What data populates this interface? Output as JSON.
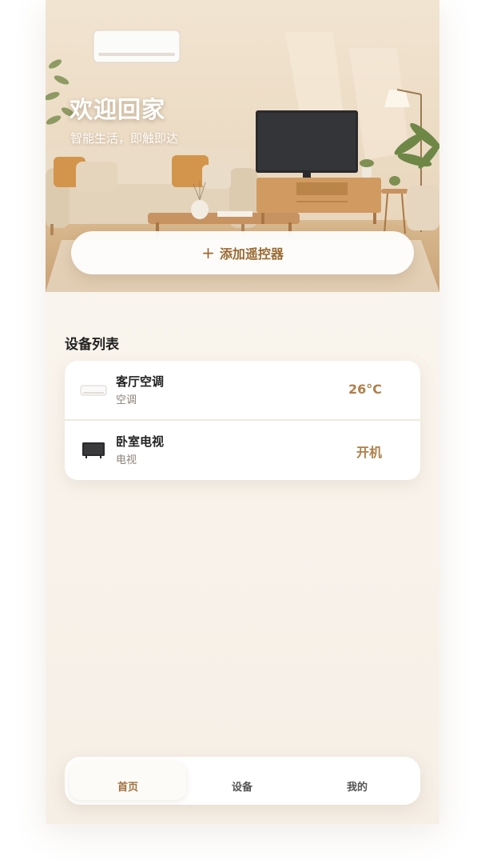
{
  "hero": {
    "title": "欢迎回家",
    "subtitle": "智能生活，即触即达",
    "add_button_label": "添加遥控器",
    "add_button_icon": "plus-icon"
  },
  "device_list": {
    "title": "设备列表",
    "items": [
      {
        "name": "客厅空调",
        "type": "空调",
        "status": "26°C",
        "icon": "air-conditioner-icon"
      },
      {
        "name": "卧室电视",
        "type": "电视",
        "status": "开机",
        "icon": "tv-icon"
      }
    ]
  },
  "tabbar": {
    "items": [
      {
        "label": "首页",
        "active": true
      },
      {
        "label": "设备",
        "active": false
      },
      {
        "label": "我的",
        "active": false
      }
    ]
  },
  "colors": {
    "accent": "#a0713d",
    "status": "#b0804a",
    "background": "#f8f2ea"
  }
}
